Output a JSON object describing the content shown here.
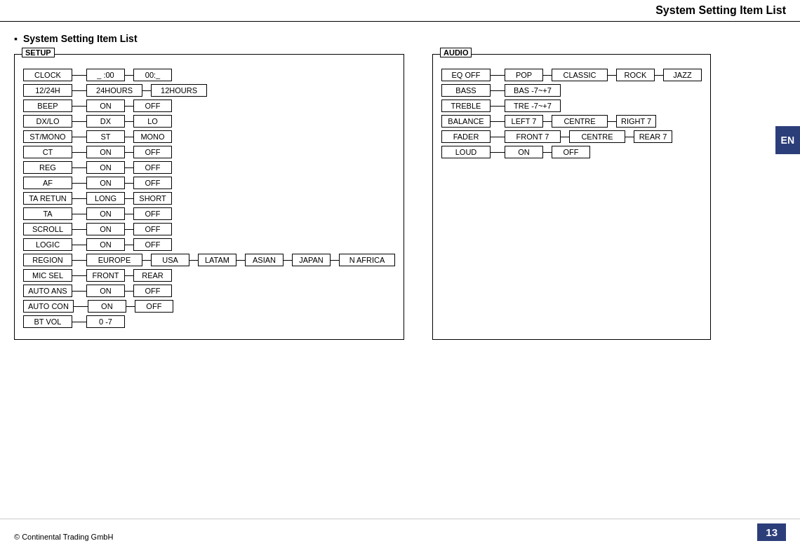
{
  "page": {
    "title": "System Setting Item List",
    "section": "System Setting Item List",
    "footer_copyright": "© Continental Trading GmbH",
    "page_number": "13",
    "lang_badge": "EN"
  },
  "setup": {
    "label": "SETUP",
    "rows": [
      {
        "label": "CLOCK",
        "values": [
          "_ :00",
          "00:_"
        ]
      },
      {
        "label": "12/24H",
        "values": [
          "24HOURS",
          "12HOURS"
        ]
      },
      {
        "label": "BEEP",
        "values": [
          "ON",
          "OFF"
        ]
      },
      {
        "label": "DX/LO",
        "values": [
          "DX",
          "LO"
        ]
      },
      {
        "label": "ST/MONO",
        "values": [
          "ST",
          "MONO"
        ]
      },
      {
        "label": "CT",
        "values": [
          "ON",
          "OFF"
        ]
      },
      {
        "label": "REG",
        "values": [
          "ON",
          "OFF"
        ]
      },
      {
        "label": "AF",
        "values": [
          "ON",
          "OFF"
        ]
      },
      {
        "label": "TA RETUN",
        "values": [
          "LONG",
          "SHORT"
        ]
      },
      {
        "label": "TA",
        "values": [
          "ON",
          "OFF"
        ]
      },
      {
        "label": "SCROLL",
        "values": [
          "ON",
          "OFF"
        ]
      },
      {
        "label": "LOGIC",
        "values": [
          "ON",
          "OFF"
        ]
      },
      {
        "label": "REGION",
        "values": [
          "EUROPE",
          "USA",
          "LATAM",
          "ASIAN",
          "JAPAN",
          "N AFRICA"
        ]
      },
      {
        "label": "MIC SEL",
        "values": [
          "FRONT",
          "REAR"
        ]
      },
      {
        "label": "AUTO ANS",
        "values": [
          "ON",
          "OFF"
        ]
      },
      {
        "label": "AUTO CON",
        "values": [
          "ON",
          "OFF"
        ]
      },
      {
        "label": "BT VOL",
        "values": [
          "0 -7"
        ]
      }
    ]
  },
  "audio": {
    "label": "AUDIO",
    "rows": [
      {
        "label": "EQ OFF",
        "values": [
          "POP",
          "CLASSIC",
          "ROCK",
          "JAZZ"
        ]
      },
      {
        "label": "BASS",
        "values": [
          "BAS -7~+7"
        ]
      },
      {
        "label": "TREBLE",
        "values": [
          "TRE -7~+7"
        ]
      },
      {
        "label": "BALANCE",
        "values": [
          "LEFT 7",
          "CENTRE",
          "RIGHT 7"
        ]
      },
      {
        "label": "FADER",
        "values": [
          "FRONT 7",
          "CENTRE",
          "REAR 7"
        ]
      },
      {
        "label": "LOUD",
        "values": [
          "ON",
          "OFF"
        ]
      }
    ]
  }
}
